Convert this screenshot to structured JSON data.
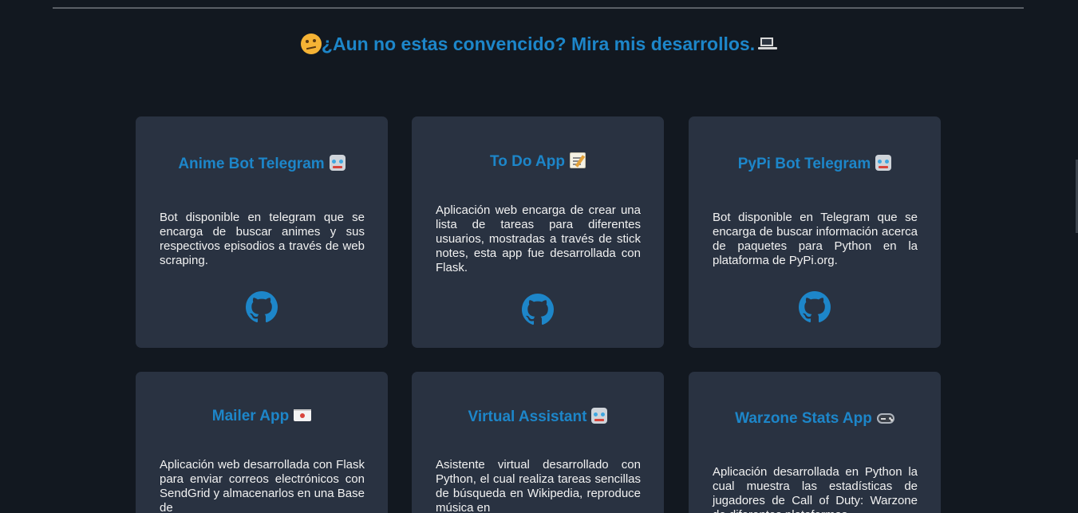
{
  "section": {
    "title": "¿Aun no estas convencido? Mira mis desarrollos.",
    "leading_icon": "thinking-face-icon",
    "trailing_icon": "laptop-icon"
  },
  "colors": {
    "background": "#121820",
    "card": "#293241",
    "accent": "#1d86c9",
    "text": "#f2f2f2"
  },
  "projects": [
    {
      "title": "Anime Bot Telegram",
      "icon": "robot-icon",
      "description": "Bot disponible en telegram que se encarga de buscar animes y sus respectivos episodios a través de web scraping.",
      "link_icon": "github-icon"
    },
    {
      "title": "To Do App",
      "icon": "memo-icon",
      "description": "Aplicación web encarga de crear una lista de tareas para diferentes usuarios, mostradas a través de stick notes, esta app fue desarrollada con Flask.",
      "link_icon": "github-icon"
    },
    {
      "title": "PyPi Bot Telegram",
      "icon": "robot-icon",
      "description": "Bot disponible en Telegram que se encarga de buscar información acerca de paquetes para Python en la plataforma de PyPi.org.",
      "link_icon": "github-icon"
    },
    {
      "title": "Mailer App",
      "icon": "envelope-icon",
      "description": "Aplicación web desarrollada con Flask para enviar correos electrónicos con SendGrid y almacenarlos en una Base de",
      "link_icon": "github-icon"
    },
    {
      "title": "Virtual Assistant",
      "icon": "robot-icon",
      "description": "Asistente virtual desarrollado con Python, el cual realiza tareas sencillas de búsqueda en Wikipedia, reproduce música en",
      "link_icon": "github-icon"
    },
    {
      "title": "Warzone Stats App",
      "icon": "gamepad-icon",
      "description": "Aplicación desarrollada en Python la cual muestra las estadísticas de jugadores de Call of Duty: Warzone de diferentes plataformas.",
      "link_icon": "github-icon"
    }
  ]
}
